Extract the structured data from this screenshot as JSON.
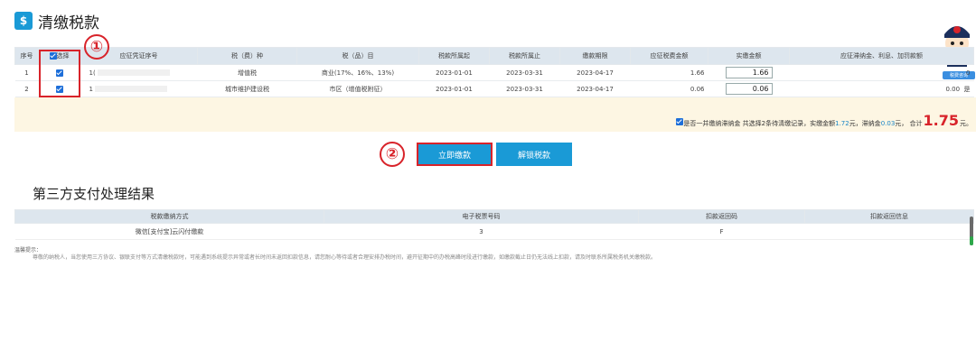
{
  "page": {
    "title": "清缴税款",
    "title_icon": "money-bag-icon"
  },
  "tax_table": {
    "headers": [
      "序号",
      "选择",
      "应征凭证序号",
      "税（费）种",
      "税（品）目",
      "税款所属起",
      "税款所属止",
      "缴款期限",
      "应征税费金额",
      "实缴金额",
      "应征滞纳金、利息、加罚款额"
    ],
    "rows": [
      {
        "no": "1",
        "voucher": "1(",
        "tax_type": "增值税",
        "item": "商业(17%、16%、13%)",
        "start": "2023-01-01",
        "end": "2023-03-31",
        "deadline": "2023-04-17",
        "amount": "1.66",
        "paid": "1.66",
        "late_fee": "0"
      },
      {
        "no": "2",
        "voucher": "1",
        "tax_type": "城市维护建设税",
        "item": "市区（增值税附征）",
        "start": "2023-01-01",
        "end": "2023-03-31",
        "deadline": "2023-04-17",
        "amount": "0.06",
        "paid": "0.06",
        "late_fee": "0.00",
        "flag": "是"
      }
    ]
  },
  "summary": {
    "label_pre": "是否一并缴纳滞纳金  共选择2条待清缴记录，实缴金额",
    "paid_total": "1.72",
    "unit1": "元，滞纳金",
    "late_total": "0.03",
    "unit2": "元，  合计",
    "grand_total": "1.75",
    "unit3": "元。"
  },
  "buttons": {
    "pay_now": "立即缴款",
    "unlock": "解锁税款"
  },
  "markers": {
    "one": "①",
    "two": "②"
  },
  "third_party": {
    "title": "第三方支付处理结果",
    "headers": [
      "税款缴纳方式",
      "电子税票号码",
      "扣款返回码",
      "扣款返回信息"
    ],
    "rows": [
      {
        "method": "微信[支付宝]云闪付缴款",
        "ticket": "3",
        "code": "F",
        "info": ""
      }
    ]
  },
  "tips": {
    "title": "温馨提示：",
    "body": "尊敬的纳税人，当您使用三方协议、银联支付等方式清缴税款时，可能遇到系统提示异常或者长时间未返回扣款信息，请您耐心等待或者合理安排办税时间，避开征期中的办税高峰时段进行缴款，如缴款截止日仍无法线上扣款，请及时联系所属税务机关缴税款。"
  },
  "mascot": {
    "button": "税费咨询"
  },
  "colors": {
    "accent": "#1a9ad6",
    "highlight": "#d8232a",
    "summary_bg": "#fdf6e3"
  }
}
